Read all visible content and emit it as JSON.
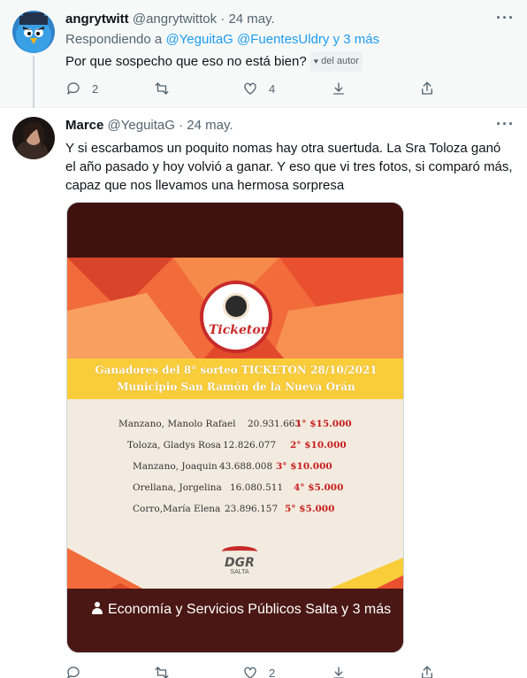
{
  "tweets": [
    {
      "name": "angrytwitt",
      "handle": "@angrytwittok",
      "date": "24 may.",
      "reply_prefix": "Respondiendo a",
      "reply_mentions": "@YeguitaG @FuentesUldry",
      "reply_more": "y 3 más",
      "text": "Por que sospecho que eso no está bien?",
      "badge": "del autor",
      "badge_icon": "heart-icon",
      "actions": {
        "reply": "2",
        "retweet": "",
        "like": "4"
      }
    },
    {
      "name": "Marce",
      "handle": "@YeguitaG",
      "date": "24 may.",
      "text": "Y si escarbamos un poquito nomas hay otra suertuda. La Sra Toloza ganó el año pasado y hoy volvió a ganar. Y eso que vi tres fotos, si comparó más, capaz que nos llevamos una hermosa sorpresa",
      "actions": {
        "reply": "",
        "retweet": "",
        "like": "2"
      }
    }
  ],
  "separator": "·",
  "more_icon": "···",
  "poster": {
    "logo_text": "Ticketon",
    "band_line1": "Ganadores  del 8° sorteo TICKETON 28/10/2021",
    "band_line2": "Municipio San Ramón de la Nueva Orán",
    "winners": [
      {
        "name": "Manzano,  Manolo Rafael",
        "dni": "20.931.663",
        "prize": "1°  $15.000"
      },
      {
        "name": "Toloza,   Gladys Rosa",
        "dni": "12.826.077",
        "prize": "2°  $10.000"
      },
      {
        "name": "Manzano,  Joaquin",
        "dni": "43.688.008",
        "prize": "3°  $10.000"
      },
      {
        "name": "Orellana,  Jorgelina",
        "dni": "16.080.511",
        "prize": "4°  $5.000"
      },
      {
        "name": "Corro,María Elena",
        "dni": "23.896.157",
        "prize": "5°  $5.000"
      }
    ],
    "dgr_text": "DGR",
    "dgr_sub": "SALTA",
    "caption": "Economía y Servicios Públicos Salta y 3 más"
  },
  "colors": {
    "accent": "#1d9bf0",
    "text": "#0f1419",
    "muted": "#536471",
    "poster_dark": "#4a1714",
    "poster_red": "#c72a2a",
    "poster_yellow": "#f9cd3a"
  }
}
